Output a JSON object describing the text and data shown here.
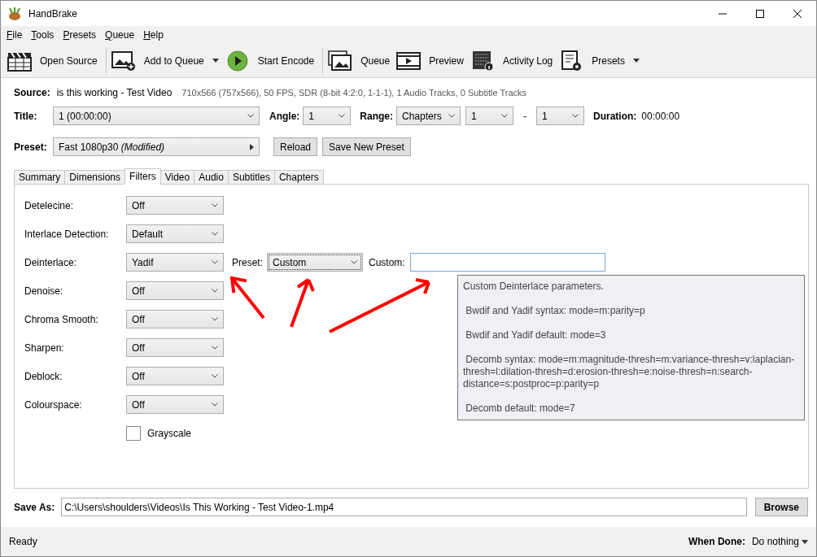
{
  "window": {
    "title": "HandBrake"
  },
  "menu": [
    {
      "label": "File"
    },
    {
      "label": "Tools"
    },
    {
      "label": "Presets"
    },
    {
      "label": "Queue"
    },
    {
      "label": "Help"
    }
  ],
  "toolbar_groups": [
    [
      {
        "label": "Open Source",
        "kind": "clapper",
        "dropdown": false
      }
    ],
    [
      {
        "label": "Add to Queue",
        "kind": "addqueue",
        "dropdown": true
      },
      {
        "label": "Start Encode",
        "kind": "play",
        "dropdown": false
      }
    ],
    [
      {
        "label": "Queue",
        "kind": "queue",
        "dropdown": false
      },
      {
        "label": "Preview",
        "kind": "film",
        "dropdown": false
      },
      {
        "label": "Activity Log",
        "kind": "log",
        "dropdown": false
      },
      {
        "label": "Presets",
        "kind": "presets",
        "dropdown": true
      }
    ]
  ],
  "source": {
    "label": "Source:",
    "name": "is this working - Test Video",
    "info": "710x566 (757x566), 50 FPS, SDR (8-bit 4:2:0, 1-1-1), 1 Audio Tracks, 0 Subtitle Tracks"
  },
  "title_row": {
    "title_label": "Title:",
    "title_value": "1  (00:00:00)",
    "angle_label": "Angle:",
    "angle_value": "1",
    "range_label": "Range:",
    "range_mode": "Chapters",
    "range_start": "1",
    "range_dash": "-",
    "range_end": "1",
    "duration_label": "Duration:",
    "duration_value": "00:00:00"
  },
  "preset_row": {
    "label": "Preset:",
    "value": "Fast 1080p30  *(Modified)*",
    "buttons": [
      "Reload",
      "Save New Preset"
    ]
  },
  "tabs": [
    {
      "label": "Summary",
      "selected": false
    },
    {
      "label": "Dimensions",
      "selected": false
    },
    {
      "label": "Filters",
      "selected": true
    },
    {
      "label": "Video",
      "selected": false
    },
    {
      "label": "Audio",
      "selected": false
    },
    {
      "label": "Subtitles",
      "selected": false
    },
    {
      "label": "Chapters",
      "selected": false
    }
  ],
  "filters": [
    {
      "label": "Detelecine:",
      "value": "Off"
    },
    {
      "label": "Interlace Detection:",
      "value": "Default"
    },
    {
      "label": "Deinterlace:",
      "value": "Yadif",
      "preset_label": "Preset:",
      "preset_value": "Custom",
      "preset_focused": true,
      "custom_label": "Custom:"
    },
    {
      "label": "Denoise:",
      "value": "Off"
    },
    {
      "label": "Chroma Smooth:",
      "value": "Off"
    },
    {
      "label": "Sharpen:",
      "value": "Off"
    },
    {
      "label": "Deblock:",
      "value": "Off"
    },
    {
      "label": "Colourspace:",
      "value": "Off"
    }
  ],
  "grayscale": {
    "label": "Grayscale",
    "checked": false
  },
  "tooltip": {
    "lines": [
      "Custom Deinterlace parameters.",
      " Bwdif and Yadif syntax: mode=m:parity=p",
      " Bwdif and Yadif default: mode=3",
      " Decomb syntax: mode=m:magnitude-thresh=m:variance-thresh=v:laplacian-thresh=l:dilation-thresh=d:erosion-thresh=e:noise-thresh=n:search-distance=s:postproc=p:parity=p",
      " Decomb default: mode=7"
    ]
  },
  "save_as": {
    "label": "Save As:",
    "value": "C:\\Users\\shoulders\\Videos\\Is This Working - Test Video-1.mp4",
    "button": "Browse"
  },
  "status_bar": {
    "status": "Ready",
    "when_done_label": "When Done:",
    "when_done_value": "Do nothing"
  }
}
